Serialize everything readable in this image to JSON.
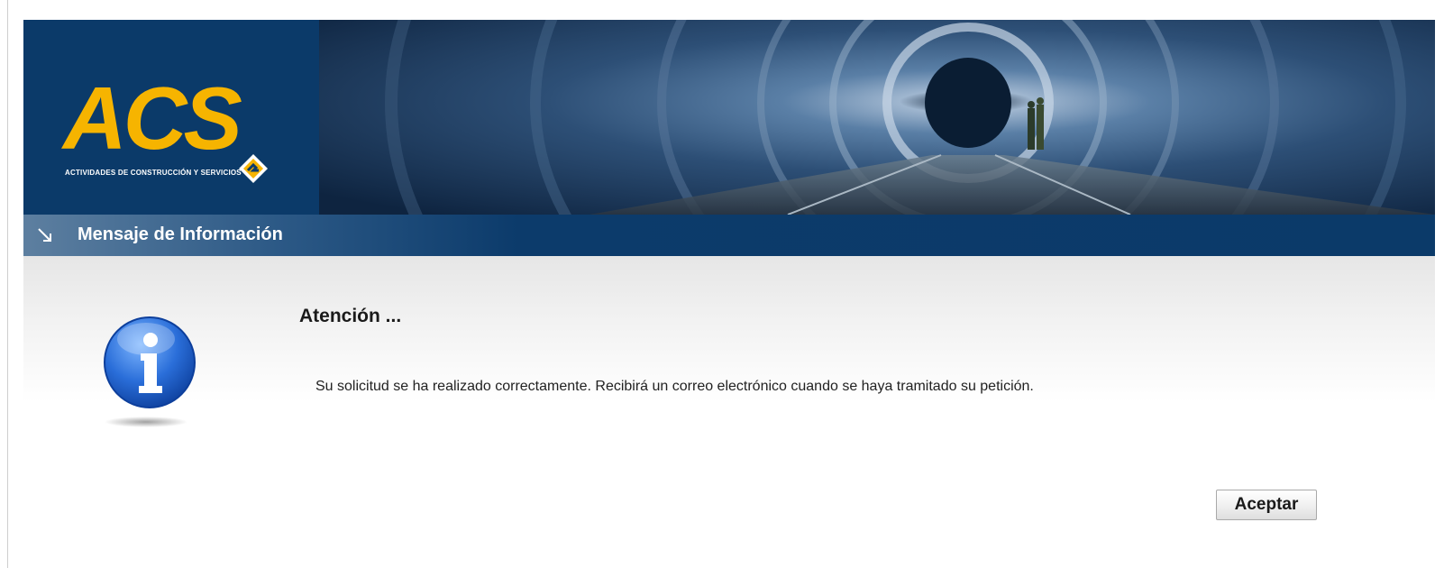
{
  "header": {
    "logo_text": "ACS",
    "logo_subtitle": "ACTIVIDADES DE CONSTRUCCIÓN Y SERVICIOS",
    "banner_image": "tunnel-photo"
  },
  "titlebar": {
    "icon": "arrow-down-right-icon",
    "title": "Mensaje de Información"
  },
  "dialog": {
    "icon": "info-icon",
    "heading": "Atención ...",
    "message": "Su solicitud se ha realizado correctamente. Recibirá un correo electrónico cuando se haya tramitado su petición.",
    "accept_label": "Aceptar"
  },
  "colors": {
    "brand_blue": "#0b3a69",
    "logo_yellow": "#f6b400"
  }
}
